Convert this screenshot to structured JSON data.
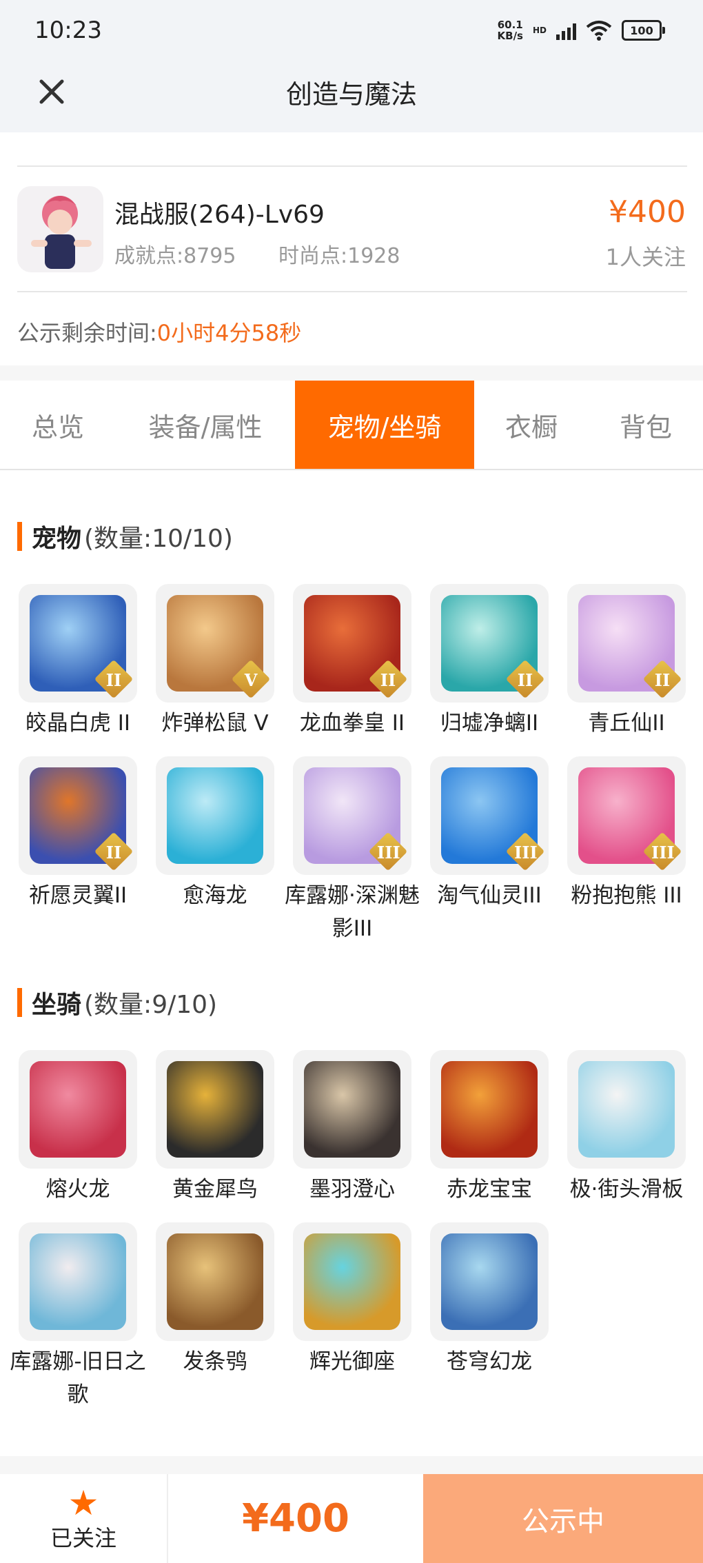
{
  "status_bar": {
    "time": "10:23",
    "net_speed_value": "60.1",
    "net_speed_unit": "KB/s",
    "hd": "HD",
    "battery": "100"
  },
  "nav": {
    "title": "创造与魔法",
    "close_icon": "close-icon"
  },
  "character": {
    "name": "混战服(264)-Lv69",
    "achievement": "成就点:8795",
    "fashion": "时尚点:1928",
    "price": "¥400",
    "followers": "1人关注"
  },
  "countdown": {
    "label": "公示剩余时间:",
    "value": "0小时4分58秒"
  },
  "tabs": [
    {
      "label": "总览",
      "active": false
    },
    {
      "label": "装备/属性",
      "active": false
    },
    {
      "label": "宠物/坐骑",
      "active": true
    },
    {
      "label": "衣橱",
      "active": false
    },
    {
      "label": "背包",
      "active": false
    }
  ],
  "pets_section": {
    "title": "宠物",
    "count": "(数量:10/10)",
    "items": [
      {
        "name": "皎晶白虎 II",
        "tier": "II",
        "colors": [
          "#2f5fb8",
          "#9fd0f5"
        ]
      },
      {
        "name": "炸弹松鼠 V",
        "tier": "V",
        "colors": [
          "#b9773d",
          "#f3c98b"
        ]
      },
      {
        "name": "龙血拳皇 II",
        "tier": "II",
        "colors": [
          "#a8261b",
          "#e86e3a"
        ]
      },
      {
        "name": "归墟净螭II",
        "tier": "II",
        "colors": [
          "#2aa7a9",
          "#bfeee8"
        ]
      },
      {
        "name": "青丘仙II",
        "tier": "II",
        "colors": [
          "#c79ae0",
          "#f6dff5"
        ]
      },
      {
        "name": "祈愿灵翼II",
        "tier": "II",
        "colors": [
          "#3b4fb0",
          "#e0762a"
        ]
      },
      {
        "name": "愈海龙",
        "tier": "",
        "colors": [
          "#2bb0d6",
          "#bdeaf6"
        ]
      },
      {
        "name": "库露娜·深渊魅影III",
        "tier": "III",
        "colors": [
          "#b89be0",
          "#f1e6f7"
        ]
      },
      {
        "name": "淘气仙灵III",
        "tier": "III",
        "colors": [
          "#2379d8",
          "#8cc6f2"
        ]
      },
      {
        "name": "粉抱抱熊 III",
        "tier": "III",
        "colors": [
          "#e3508a",
          "#f7b1cb"
        ]
      }
    ]
  },
  "mounts_section": {
    "title": "坐骑",
    "count": "(数量:9/10)",
    "items": [
      {
        "name": "熔火龙",
        "colors": [
          "#c8304a",
          "#f08aa0"
        ]
      },
      {
        "name": "黄金犀鸟",
        "colors": [
          "#2b2b2b",
          "#e6b23a"
        ]
      },
      {
        "name": "墨羽澄心",
        "colors": [
          "#3a3230",
          "#d9c6a8"
        ]
      },
      {
        "name": "赤龙宝宝",
        "colors": [
          "#b02a14",
          "#f2a13a"
        ]
      },
      {
        "name": "极·街头滑板",
        "colors": [
          "#8fd0e6",
          "#f4f4f4"
        ]
      },
      {
        "name": "库露娜-旧日之歌",
        "colors": [
          "#6fb7d8",
          "#f1ecef"
        ]
      },
      {
        "name": "发条鸮",
        "colors": [
          "#8a5a2b",
          "#e7c27a"
        ]
      },
      {
        "name": "辉光御座",
        "colors": [
          "#d79a2a",
          "#66d3e0"
        ]
      },
      {
        "name": "苍穹幻龙",
        "colors": [
          "#3b6fb5",
          "#a8d8ef"
        ]
      }
    ]
  },
  "bottom_bar": {
    "follow_label": "已关注",
    "price": "¥400",
    "status": "公示中"
  },
  "colors": {
    "accent": "#ff6a00",
    "price": "#f36b1c",
    "status_button": "#fba97a"
  }
}
